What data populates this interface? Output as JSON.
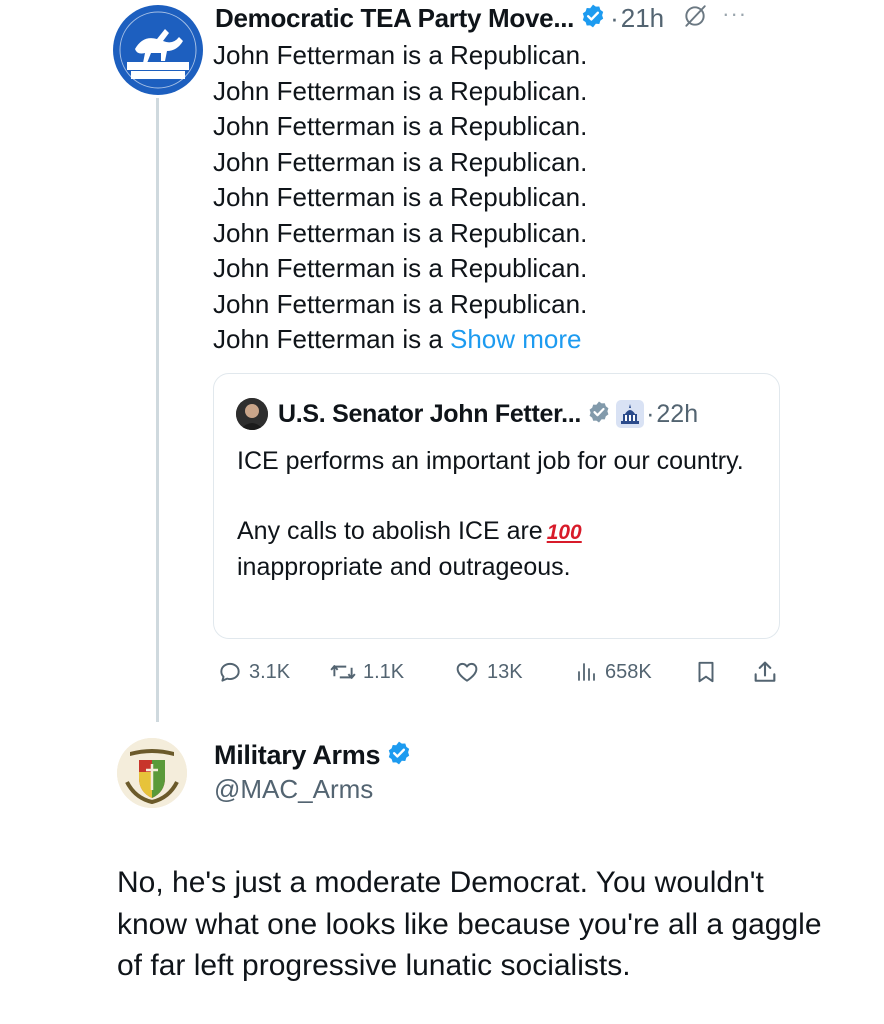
{
  "tweet": {
    "author_name": "Democratic TEA Party Move...",
    "time": "21h",
    "avatar_text_top": "DEMOCRATIC",
    "avatar_text_bottom": "TEA PARTY",
    "lines": [
      "John Fetterman is a Republican.",
      "John Fetterman is a Republican.",
      "John Fetterman is a Republican.",
      "John Fetterman is a Republican.",
      "John Fetterman is a Republican.",
      "John Fetterman is a Republican.",
      "John Fetterman is a Republican.",
      "John Fetterman is a Republican."
    ],
    "truncated_line": "John Fetterman is a ",
    "show_more": "Show more",
    "actions": {
      "replies": "3.1K",
      "reposts": "1.1K",
      "likes": "13K",
      "views": "658K"
    }
  },
  "quote": {
    "author_name": "U.S. Senator John Fetter...",
    "time": "22h",
    "para1": "ICE performs an important job for our country.",
    "para2": "Any calls to abolish ICE are",
    "emoji": "100",
    "para2_end": "inappropriate and outrageous."
  },
  "reply": {
    "author_name": "Military Arms",
    "handle": "@MAC_Arms",
    "text": "No, he's just a moderate Democrat. You wouldn't know what one looks like because you're all a gaggle of far left progressive lunatic socialists."
  },
  "colors": {
    "accent": "#1d9bf0",
    "muted": "#536471",
    "thread_line": "#cfd9de"
  }
}
